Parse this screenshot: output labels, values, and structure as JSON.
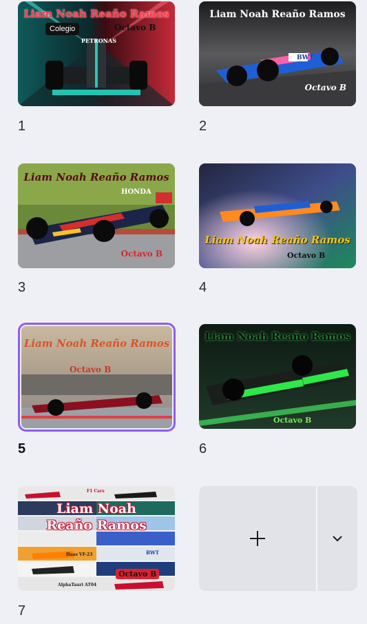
{
  "pages": [
    {
      "number": "1",
      "title": "Liam Noah Reaño Ramos",
      "tag": "Colegio",
      "subtitle": "Octavo B",
      "sponsor": "PETRONAS"
    },
    {
      "number": "2",
      "title": "Liam Noah Reaño Ramos",
      "subtitle": "Octavo B",
      "sponsor": "BWT"
    },
    {
      "number": "3",
      "title": "Liam Noah Reaño Ramos",
      "subtitle": "Octavo B",
      "sponsor": "HONDA"
    },
    {
      "number": "4",
      "title": "Liam Noah Reaño Ramos",
      "subtitle": "Octavo B"
    },
    {
      "number": "5",
      "title": "Liam Noah Reaño Ramos",
      "subtitle": "Octavo B"
    },
    {
      "number": "6",
      "title": "Liam Noah Reaño Ramos",
      "subtitle": "Octavo B"
    },
    {
      "number": "7",
      "title_line1": "Liam Noah",
      "title_line2": "Reaño Ramos",
      "subtitle": "Octavo B",
      "labels": [
        "F1 Cars",
        "Haas VF-23",
        "AlphaTauri AT04",
        "BWT"
      ]
    }
  ],
  "controls": {
    "add_icon": "plus-icon",
    "more_icon": "chevron-down-icon"
  },
  "colors": {
    "selected_border": "#8b5cf6",
    "background": "#eff0f5",
    "add_area": "#e2e3e9"
  }
}
